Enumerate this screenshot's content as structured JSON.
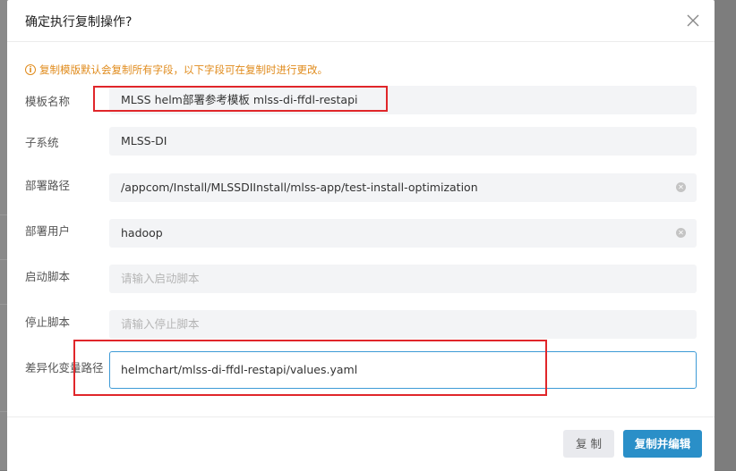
{
  "dialog": {
    "title": "确定执行复制操作?",
    "notice": "复制模版默认会复制所有字段，以下字段可在复制时进行更改。",
    "notice_icon": "info-icon",
    "close_icon": "close-icon"
  },
  "fields": [
    {
      "label": "模板名称",
      "value": "MLSS helm部署参考模板 mlss-di-ffdl-restapi",
      "placeholder": "",
      "clearable": false
    },
    {
      "label": "子系统",
      "value": "MLSS-DI",
      "placeholder": "",
      "clearable": false
    },
    {
      "label": "部署路径",
      "value": "/appcom/Install/MLSSDIInstall/mlss-app/test-install-optimization",
      "placeholder": "",
      "clearable": true
    },
    {
      "label": "部署用户",
      "value": "hadoop",
      "placeholder": "",
      "clearable": true
    },
    {
      "label": "启动脚本",
      "value": "",
      "placeholder": "请输入启动脚本",
      "clearable": false
    },
    {
      "label": "停止脚本",
      "value": "",
      "placeholder": "请输入停止脚本",
      "clearable": false
    },
    {
      "label": "差异化变量路径",
      "value": "helmchart/mlss-di-ffdl-restapi/values.yaml",
      "placeholder": "",
      "clearable": false
    }
  ],
  "buttons": {
    "copy": "复 制",
    "copy_and_edit": "复制并编辑"
  },
  "colors": {
    "accent": "#2a8fc8",
    "notice": "#e08b1c",
    "highlight_box": "#e0262a",
    "active_border": "#3d9ad6"
  }
}
